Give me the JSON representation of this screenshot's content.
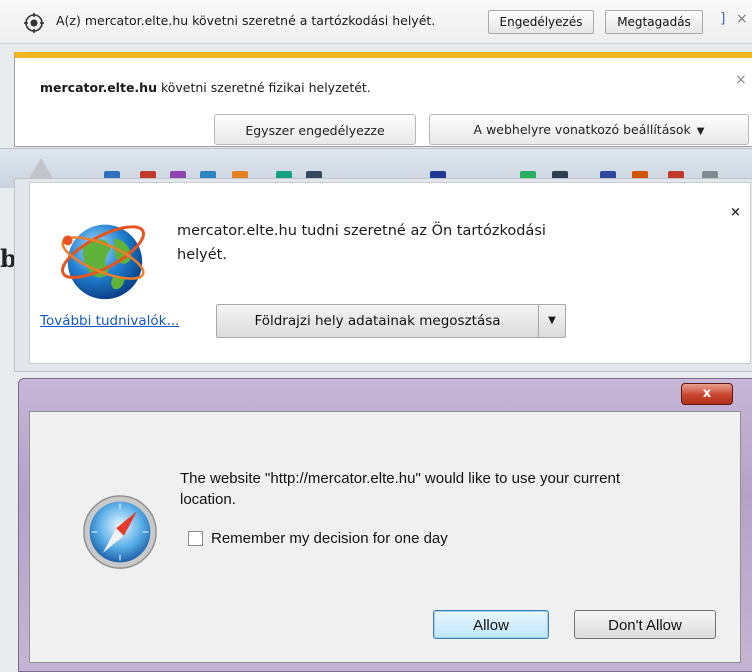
{
  "ie_bar": {
    "message": "A(z) mercator.elte.hu követni szeretné a tartózkodási helyét.",
    "allow_label": "Engedélyezés",
    "deny_label": "Megtagadás",
    "more_glyph": "]",
    "close_glyph": "×"
  },
  "firefox_bar": {
    "site": "mercator.elte.hu",
    "message": " követni szeretné fizikai helyzetét.",
    "allow_once_label": "Egyszer engedélyezze",
    "settings_label": "A webhelyre vonatkozó beállítások",
    "close_glyph": "×"
  },
  "background_page": {
    "partial_letter": "b"
  },
  "chrome_bar": {
    "message": "mercator.elte.hu tudni szeretné az Ön tartózkodási helyét.",
    "learn_more_label": "További tudnivalók...",
    "share_label": "Földrajzi hely adatainak megosztása",
    "close_glyph": "×"
  },
  "safari_dialog": {
    "close_glyph": "x",
    "message": "The website \"http://mercator.elte.hu\" would like to use your current location.",
    "remember_label": "Remember my decision for one day",
    "remember_checked": false,
    "allow_label": "Allow",
    "deny_label": "Don't Allow"
  },
  "colors": {
    "firefox_accent": "#f1b520",
    "link_blue": "#1458c8",
    "win7_frame": "#b6a2c9",
    "win7_close_red": "#c9452f"
  }
}
